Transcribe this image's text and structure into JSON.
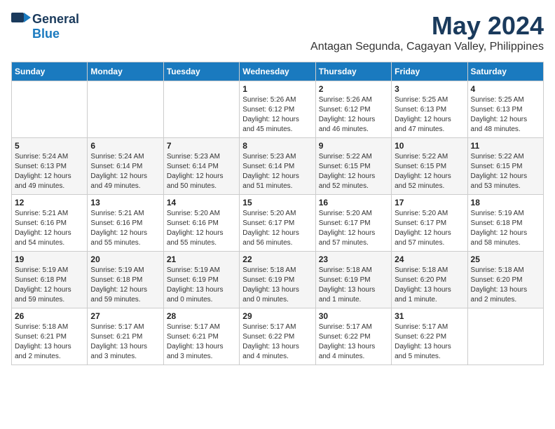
{
  "logo": {
    "general": "General",
    "blue": "Blue"
  },
  "header": {
    "month": "May 2024",
    "location": "Antagan Segunda, Cagayan Valley, Philippines"
  },
  "weekdays": [
    "Sunday",
    "Monday",
    "Tuesday",
    "Wednesday",
    "Thursday",
    "Friday",
    "Saturday"
  ],
  "weeks": [
    [
      {
        "day": "",
        "info": ""
      },
      {
        "day": "",
        "info": ""
      },
      {
        "day": "",
        "info": ""
      },
      {
        "day": "1",
        "info": "Sunrise: 5:26 AM\nSunset: 6:12 PM\nDaylight: 12 hours\nand 45 minutes."
      },
      {
        "day": "2",
        "info": "Sunrise: 5:26 AM\nSunset: 6:12 PM\nDaylight: 12 hours\nand 46 minutes."
      },
      {
        "day": "3",
        "info": "Sunrise: 5:25 AM\nSunset: 6:13 PM\nDaylight: 12 hours\nand 47 minutes."
      },
      {
        "day": "4",
        "info": "Sunrise: 5:25 AM\nSunset: 6:13 PM\nDaylight: 12 hours\nand 48 minutes."
      }
    ],
    [
      {
        "day": "5",
        "info": "Sunrise: 5:24 AM\nSunset: 6:13 PM\nDaylight: 12 hours\nand 49 minutes."
      },
      {
        "day": "6",
        "info": "Sunrise: 5:24 AM\nSunset: 6:14 PM\nDaylight: 12 hours\nand 49 minutes."
      },
      {
        "day": "7",
        "info": "Sunrise: 5:23 AM\nSunset: 6:14 PM\nDaylight: 12 hours\nand 50 minutes."
      },
      {
        "day": "8",
        "info": "Sunrise: 5:23 AM\nSunset: 6:14 PM\nDaylight: 12 hours\nand 51 minutes."
      },
      {
        "day": "9",
        "info": "Sunrise: 5:22 AM\nSunset: 6:15 PM\nDaylight: 12 hours\nand 52 minutes."
      },
      {
        "day": "10",
        "info": "Sunrise: 5:22 AM\nSunset: 6:15 PM\nDaylight: 12 hours\nand 52 minutes."
      },
      {
        "day": "11",
        "info": "Sunrise: 5:22 AM\nSunset: 6:15 PM\nDaylight: 12 hours\nand 53 minutes."
      }
    ],
    [
      {
        "day": "12",
        "info": "Sunrise: 5:21 AM\nSunset: 6:16 PM\nDaylight: 12 hours\nand 54 minutes."
      },
      {
        "day": "13",
        "info": "Sunrise: 5:21 AM\nSunset: 6:16 PM\nDaylight: 12 hours\nand 55 minutes."
      },
      {
        "day": "14",
        "info": "Sunrise: 5:20 AM\nSunset: 6:16 PM\nDaylight: 12 hours\nand 55 minutes."
      },
      {
        "day": "15",
        "info": "Sunrise: 5:20 AM\nSunset: 6:17 PM\nDaylight: 12 hours\nand 56 minutes."
      },
      {
        "day": "16",
        "info": "Sunrise: 5:20 AM\nSunset: 6:17 PM\nDaylight: 12 hours\nand 57 minutes."
      },
      {
        "day": "17",
        "info": "Sunrise: 5:20 AM\nSunset: 6:17 PM\nDaylight: 12 hours\nand 57 minutes."
      },
      {
        "day": "18",
        "info": "Sunrise: 5:19 AM\nSunset: 6:18 PM\nDaylight: 12 hours\nand 58 minutes."
      }
    ],
    [
      {
        "day": "19",
        "info": "Sunrise: 5:19 AM\nSunset: 6:18 PM\nDaylight: 12 hours\nand 59 minutes."
      },
      {
        "day": "20",
        "info": "Sunrise: 5:19 AM\nSunset: 6:18 PM\nDaylight: 12 hours\nand 59 minutes."
      },
      {
        "day": "21",
        "info": "Sunrise: 5:19 AM\nSunset: 6:19 PM\nDaylight: 13 hours\nand 0 minutes."
      },
      {
        "day": "22",
        "info": "Sunrise: 5:18 AM\nSunset: 6:19 PM\nDaylight: 13 hours\nand 0 minutes."
      },
      {
        "day": "23",
        "info": "Sunrise: 5:18 AM\nSunset: 6:19 PM\nDaylight: 13 hours\nand 1 minute."
      },
      {
        "day": "24",
        "info": "Sunrise: 5:18 AM\nSunset: 6:20 PM\nDaylight: 13 hours\nand 1 minute."
      },
      {
        "day": "25",
        "info": "Sunrise: 5:18 AM\nSunset: 6:20 PM\nDaylight: 13 hours\nand 2 minutes."
      }
    ],
    [
      {
        "day": "26",
        "info": "Sunrise: 5:18 AM\nSunset: 6:21 PM\nDaylight: 13 hours\nand 2 minutes."
      },
      {
        "day": "27",
        "info": "Sunrise: 5:17 AM\nSunset: 6:21 PM\nDaylight: 13 hours\nand 3 minutes."
      },
      {
        "day": "28",
        "info": "Sunrise: 5:17 AM\nSunset: 6:21 PM\nDaylight: 13 hours\nand 3 minutes."
      },
      {
        "day": "29",
        "info": "Sunrise: 5:17 AM\nSunset: 6:22 PM\nDaylight: 13 hours\nand 4 minutes."
      },
      {
        "day": "30",
        "info": "Sunrise: 5:17 AM\nSunset: 6:22 PM\nDaylight: 13 hours\nand 4 minutes."
      },
      {
        "day": "31",
        "info": "Sunrise: 5:17 AM\nSunset: 6:22 PM\nDaylight: 13 hours\nand 5 minutes."
      },
      {
        "day": "",
        "info": ""
      }
    ]
  ]
}
